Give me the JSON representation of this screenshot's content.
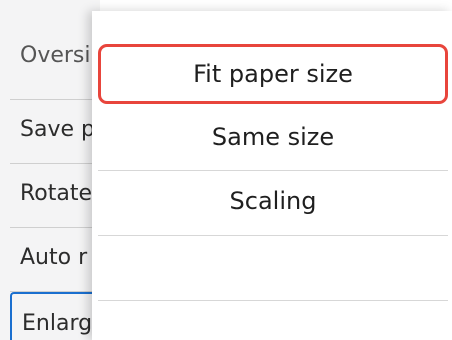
{
  "background_menu": {
    "items": [
      {
        "label": "Oversi"
      },
      {
        "label": "Save p"
      },
      {
        "label": "Rotate"
      },
      {
        "label": "Auto r"
      },
      {
        "label": "Enlarg"
      }
    ]
  },
  "popup": {
    "options": [
      {
        "label": "Fit paper size",
        "focused": true
      },
      {
        "label": "Same size"
      },
      {
        "label": "Scaling"
      },
      {
        "label": ""
      }
    ]
  },
  "colors": {
    "focus_border": "#e8453c",
    "selected_border": "#1a6fcf"
  }
}
